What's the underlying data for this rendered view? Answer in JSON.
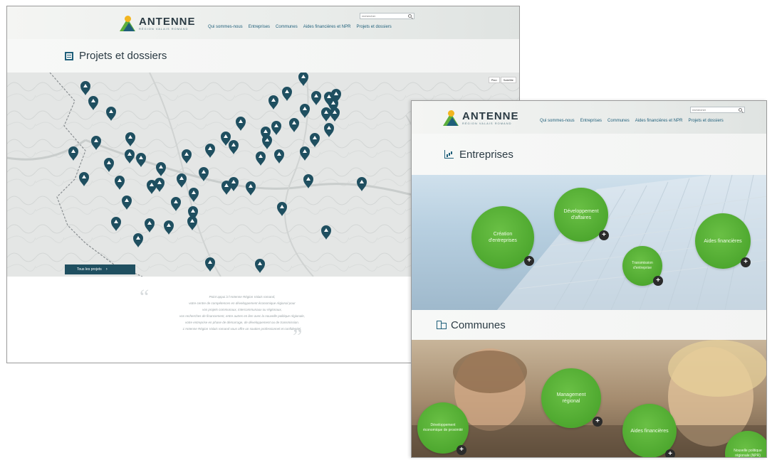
{
  "brand": {
    "title": "ANTENNE",
    "subtitle": "RÉGION VALAIS ROMAND"
  },
  "nav": [
    "Qui sommes-nous",
    "Entreprises",
    "Communes",
    "Aides financières et NPR",
    "Projets et dossiers"
  ],
  "search": {
    "placeholder": "rechercher"
  },
  "page_a": {
    "section_title": "Projets et dossiers",
    "map_toggle": [
      "Plan",
      "Satellite"
    ],
    "all_projects_button": "Tous les projets",
    "quote_lines": [
      "Point appui à l'Antenne Région Valais romand,",
      "votre centre de compétences en développement économique régional pour",
      "vos projets communaux, intercommunaux ou régionaux,",
      "vos recherches de financement, entre autres en lien avec la nouvelle politique régionale,",
      "votre entreprise en phase de démarrage, de développement ou de transmission.",
      "L'Antenne Région Valais romand vous offre un soutien professionnel et confidentiel."
    ]
  },
  "page_b": {
    "section_entreprises": "Entreprises",
    "section_communes": "Communes",
    "entreprises_bubbles": [
      "Création d'entreprises",
      "Développement d'affaires",
      "Aides financières",
      "Transmission d'entreprise"
    ],
    "communes_bubbles": [
      "Développement économique de proximité",
      "Management régional",
      "Aides financières",
      "Nouvelle politique régionale (NPR)"
    ]
  },
  "colors": {
    "accent_green": "#4ea82f",
    "brand_blue": "#1f5f7a",
    "marker": "#1f4f60"
  }
}
